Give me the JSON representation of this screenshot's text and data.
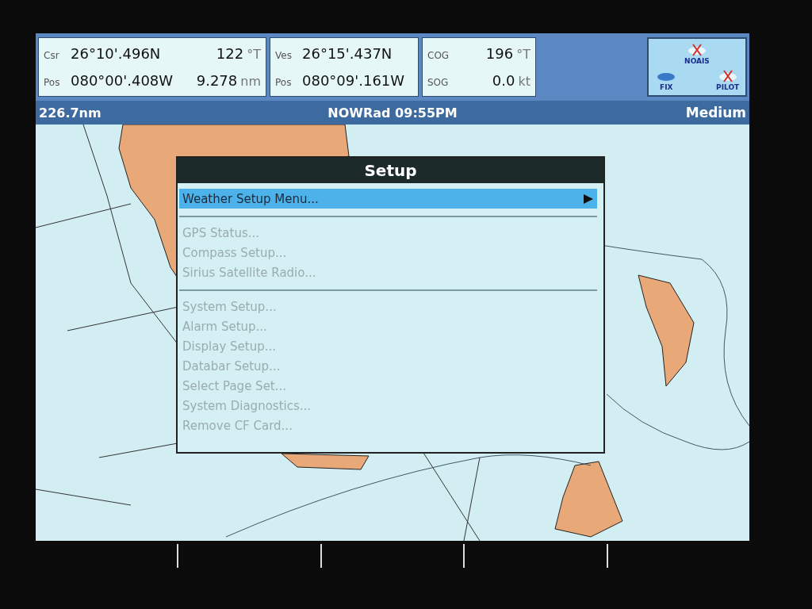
{
  "databar": [
    {
      "rows": [
        {
          "label": "Csr",
          "value": "26°10'.496N",
          "reading": "122",
          "unit": "°T"
        },
        {
          "label": "Pos",
          "value": "080°00'.408W",
          "reading": "9.278",
          "unit": "nm"
        }
      ]
    },
    {
      "rows": [
        {
          "label": "Ves",
          "value": "26°15'.437N"
        },
        {
          "label": "Pos",
          "value": "080°09'.161W"
        }
      ]
    },
    {
      "rows": [
        {
          "label": "COG",
          "reading": "196",
          "unit": "°T"
        },
        {
          "label": "SOG",
          "reading": "0.0",
          "unit": "kt"
        }
      ]
    }
  ],
  "status_icons": [
    {
      "label": "FIX",
      "crossed": false
    },
    {
      "label": "NOAIS",
      "crossed": true
    },
    {
      "label": "PILOT",
      "crossed": true
    }
  ],
  "header": {
    "range": "226.7nm",
    "title": "NOWRad 09:55PM",
    "mode": "Medium"
  },
  "menu": {
    "title": "Setup",
    "groups": [
      {
        "items": [
          {
            "label": "Weather Setup Menu...",
            "selected": true,
            "submenu": true
          }
        ]
      },
      {
        "items": [
          {
            "label": "GPS Status...",
            "selected": false,
            "submenu": false
          },
          {
            "label": "Compass Setup...",
            "selected": false,
            "submenu": false
          },
          {
            "label": "Sirius Satellite Radio...",
            "selected": false,
            "submenu": false
          }
        ]
      },
      {
        "items": [
          {
            "label": "System Setup...",
            "selected": false,
            "submenu": false
          },
          {
            "label": "Alarm Setup...",
            "selected": false,
            "submenu": false
          },
          {
            "label": "Display Setup...",
            "selected": false,
            "submenu": false
          },
          {
            "label": "Databar Setup...",
            "selected": false,
            "submenu": false
          },
          {
            "label": "Select Page Set...",
            "selected": false,
            "submenu": false
          },
          {
            "label": "System Diagnostics...",
            "selected": false,
            "submenu": false
          },
          {
            "label": "Remove CF Card...",
            "selected": false,
            "submenu": false
          }
        ]
      }
    ]
  }
}
